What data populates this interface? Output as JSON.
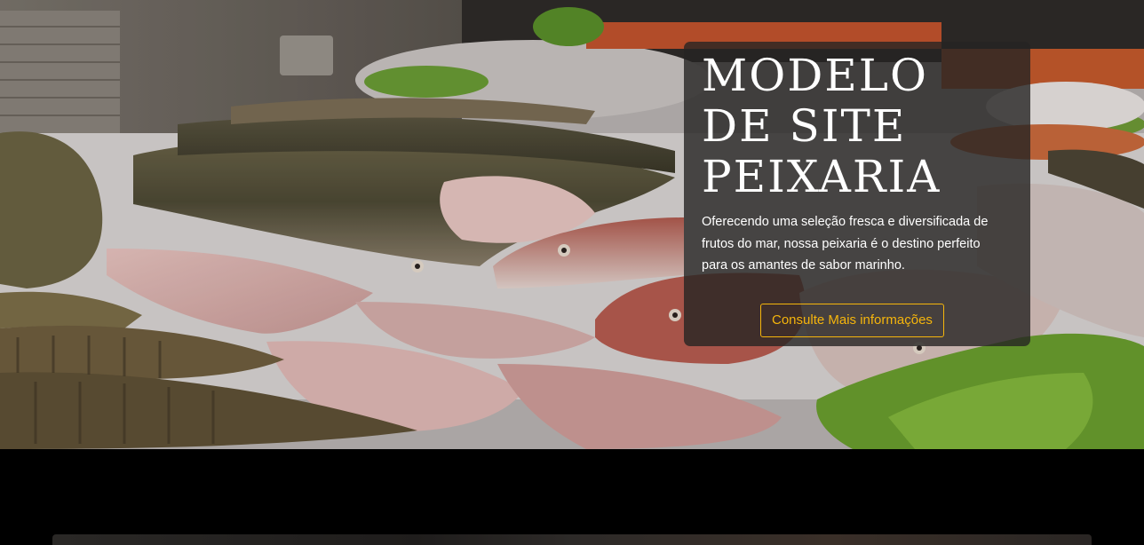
{
  "hero": {
    "background_image": "fish-on-ice-image",
    "title_lines": [
      "MODELO",
      "DE SITE",
      "PEIXARIA"
    ],
    "description": "Oferecendo uma seleção fresca e diversificada de frutos do mar, nossa peixaria é o destino perfeito para os amantes de sabor marinho.",
    "cta_label": "Consulte Mais informações",
    "accent_color": "#f5b50c",
    "card_color": "#262423"
  },
  "next_section": {
    "background_image": "dark-wood-image"
  }
}
